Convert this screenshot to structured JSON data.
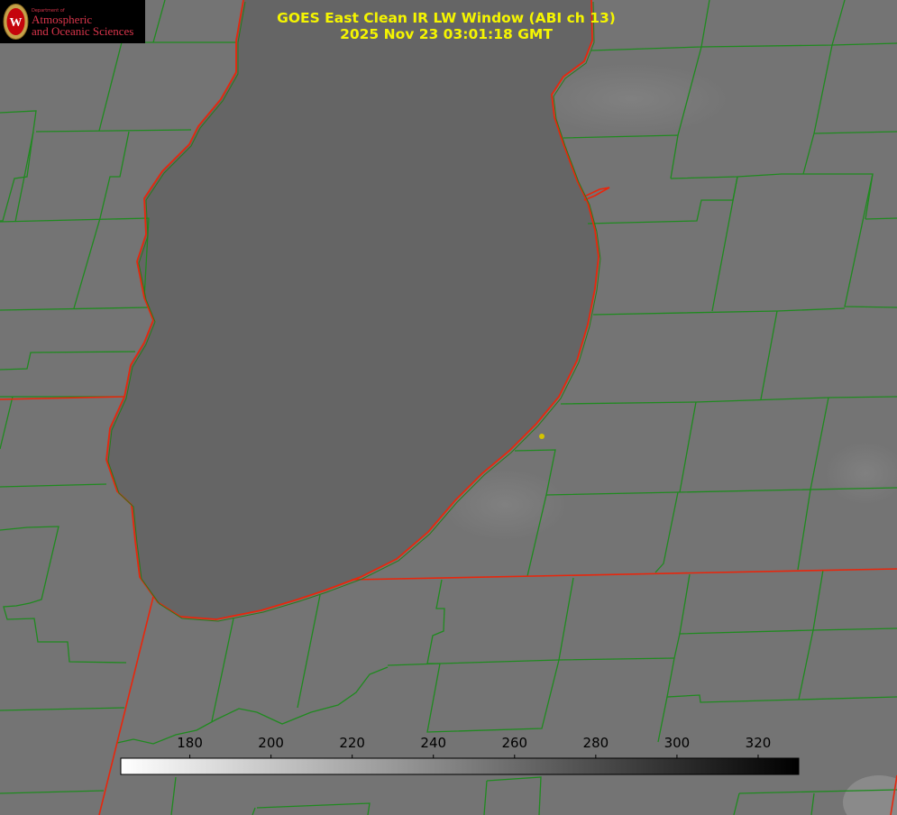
{
  "logo": {
    "department_label": "Department of",
    "line1": "Atmospheric",
    "line2": "and Oceanic Sciences",
    "seal_letter": "W"
  },
  "title": {
    "line1": "GOES East Clean IR LW Window (ABI ch 13)",
    "line2": "2025 Nov 23 03:01:18 GMT"
  },
  "colorbar": {
    "min": 163,
    "max": 330,
    "ticks": [
      180,
      200,
      220,
      240,
      260,
      280,
      300,
      320
    ],
    "colormap": "white-to-black"
  },
  "colors": {
    "background": "#747474",
    "lake": "#656565",
    "county_lines": "#1f8a1f",
    "state_lines": "#e8260c",
    "title_text": "#f5f500",
    "marker": "#d4c400"
  },
  "marker": {
    "shape": "dot"
  }
}
